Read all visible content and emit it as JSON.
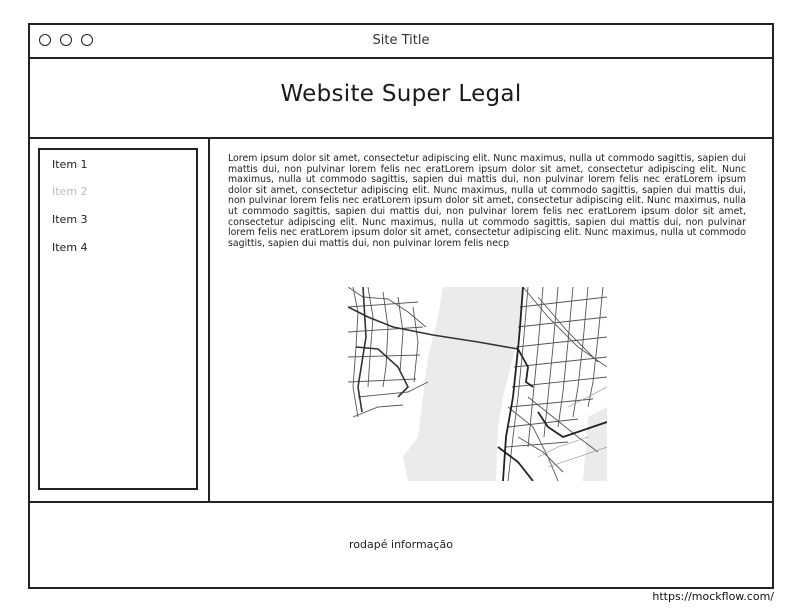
{
  "window": {
    "title": "Site Title"
  },
  "header": {
    "title": "Website Super Legal"
  },
  "sidebar": {
    "items": [
      {
        "label": "Item 1",
        "state": "normal"
      },
      {
        "label": "Item 2",
        "state": "disabled"
      },
      {
        "label": "Item 3",
        "state": "normal"
      },
      {
        "label": "Item 4",
        "state": "normal"
      }
    ]
  },
  "main": {
    "body_text": "Lorem ipsum dolor sit amet, consectetur adipiscing elit. Nunc maximus, nulla ut commodo sagittis, sapien dui mattis dui, non pulvinar lorem felis nec eratLorem ipsum dolor sit amet, consectetur adipiscing elit. Nunc maximus, nulla ut commodo sagittis, sapien dui mattis dui, non pulvinar lorem felis nec eratLorem ipsum dolor sit amet, consectetur adipiscing elit. Nunc maximus, nulla ut commodo sagittis, sapien dui mattis dui, non pulvinar lorem felis nec eratLorem ipsum dolor sit amet, consectetur adipiscing elit. Nunc maximus, nulla ut commodo sagittis, sapien dui mattis dui, non pulvinar lorem felis nec eratLorem ipsum dolor sit amet, consectetur adipiscing elit. Nunc maximus, nulla ut commodo sagittis, sapien dui mattis dui, non pulvinar lorem felis nec eratLorem ipsum dolor sit amet, consectetur adipiscing elit. Nunc maximus, nulla ut commodo sagittis, sapien dui mattis dui, non pulvinar lorem felis necp",
    "map_icon": "street-map-image"
  },
  "footer": {
    "text": "rodapé informação"
  },
  "watermark": {
    "text": "https://mockflow.com/"
  },
  "colors": {
    "stroke": "#222222",
    "disabled_text": "#bbbbbb",
    "map_water": "#e8e8e8"
  }
}
